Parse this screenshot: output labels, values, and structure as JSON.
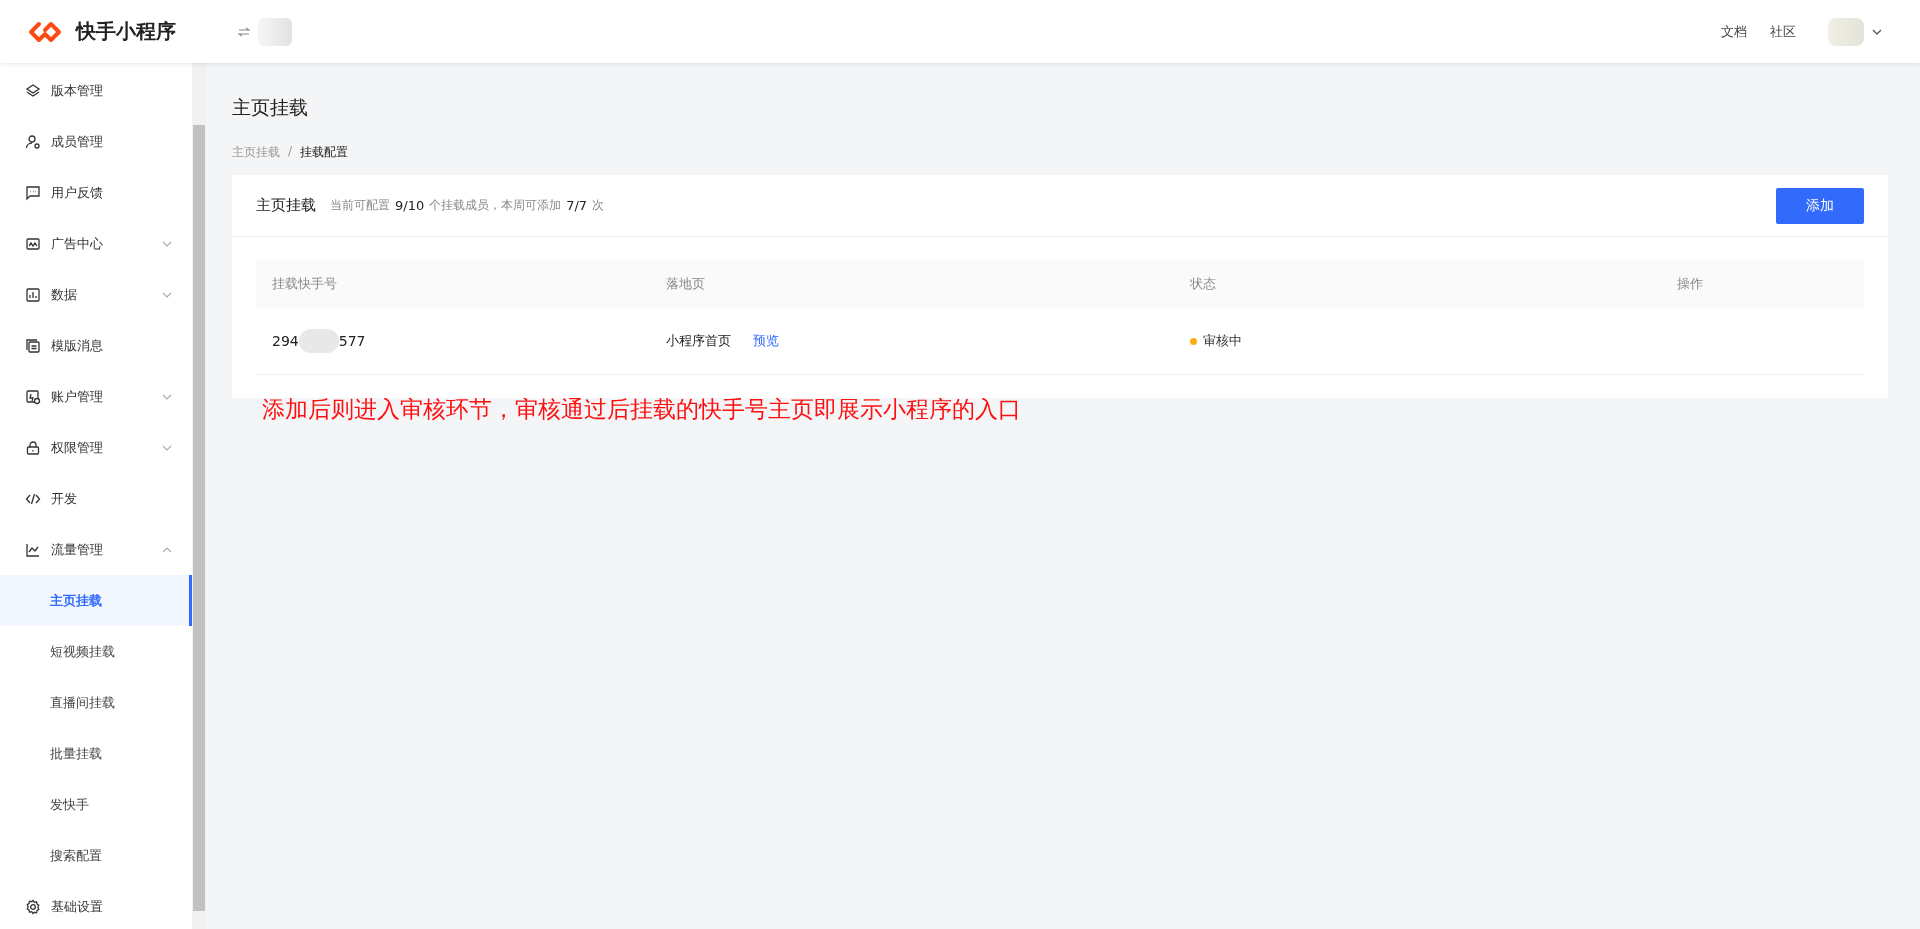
{
  "header": {
    "brand": "快手小程序",
    "links": [
      "文档",
      "社区"
    ]
  },
  "sidebar": {
    "items": [
      {
        "label": "版本管理",
        "kind": "item"
      },
      {
        "label": "成员管理",
        "kind": "item"
      },
      {
        "label": "用户反馈",
        "kind": "item"
      },
      {
        "label": "广告中心",
        "kind": "group",
        "expanded": false
      },
      {
        "label": "数据",
        "kind": "group",
        "expanded": false
      },
      {
        "label": "模版消息",
        "kind": "item"
      },
      {
        "label": "账户管理",
        "kind": "group",
        "expanded": false
      },
      {
        "label": "权限管理",
        "kind": "group",
        "expanded": false
      },
      {
        "label": "开发",
        "kind": "item"
      },
      {
        "label": "流量管理",
        "kind": "group",
        "expanded": true,
        "children": [
          {
            "label": "主页挂载",
            "selected": true
          },
          {
            "label": "短视频挂载",
            "selected": false
          },
          {
            "label": "直播间挂载",
            "selected": false
          },
          {
            "label": "批量挂载",
            "selected": false
          },
          {
            "label": "发快手",
            "selected": false
          },
          {
            "label": "搜索配置",
            "selected": false
          }
        ]
      },
      {
        "label": "基础设置",
        "kind": "item"
      }
    ]
  },
  "page_title": "主页挂载",
  "breadcrumb_separator": "/",
  "breadcrumb": [
    {
      "label": "主页挂载",
      "current": false
    },
    {
      "label": "挂载配置",
      "current": true
    }
  ],
  "card": {
    "title": "主页挂载",
    "summary": [
      {
        "text": "当前可配置",
        "highlight": false
      },
      {
        "text": "9/10",
        "highlight": true
      },
      {
        "text": "个挂载成员，本周可添加",
        "highlight": false
      },
      {
        "text": "7/7",
        "highlight": true
      },
      {
        "text": "次",
        "highlight": false
      }
    ],
    "add_button": "添加",
    "table": {
      "columns": [
        "挂载快手号",
        "落地页",
        "状态",
        "操作"
      ],
      "rows": [
        {
          "account_start": "294",
          "account_end": "577",
          "landing_page": "小程序首页",
          "preview_link": "预览",
          "status": {
            "text": "审核中",
            "color": "#faad14"
          }
        }
      ]
    }
  },
  "annotation": "添加后则进入审核环节，审核通过后挂载的快手号主页即展示小程序的入口"
}
